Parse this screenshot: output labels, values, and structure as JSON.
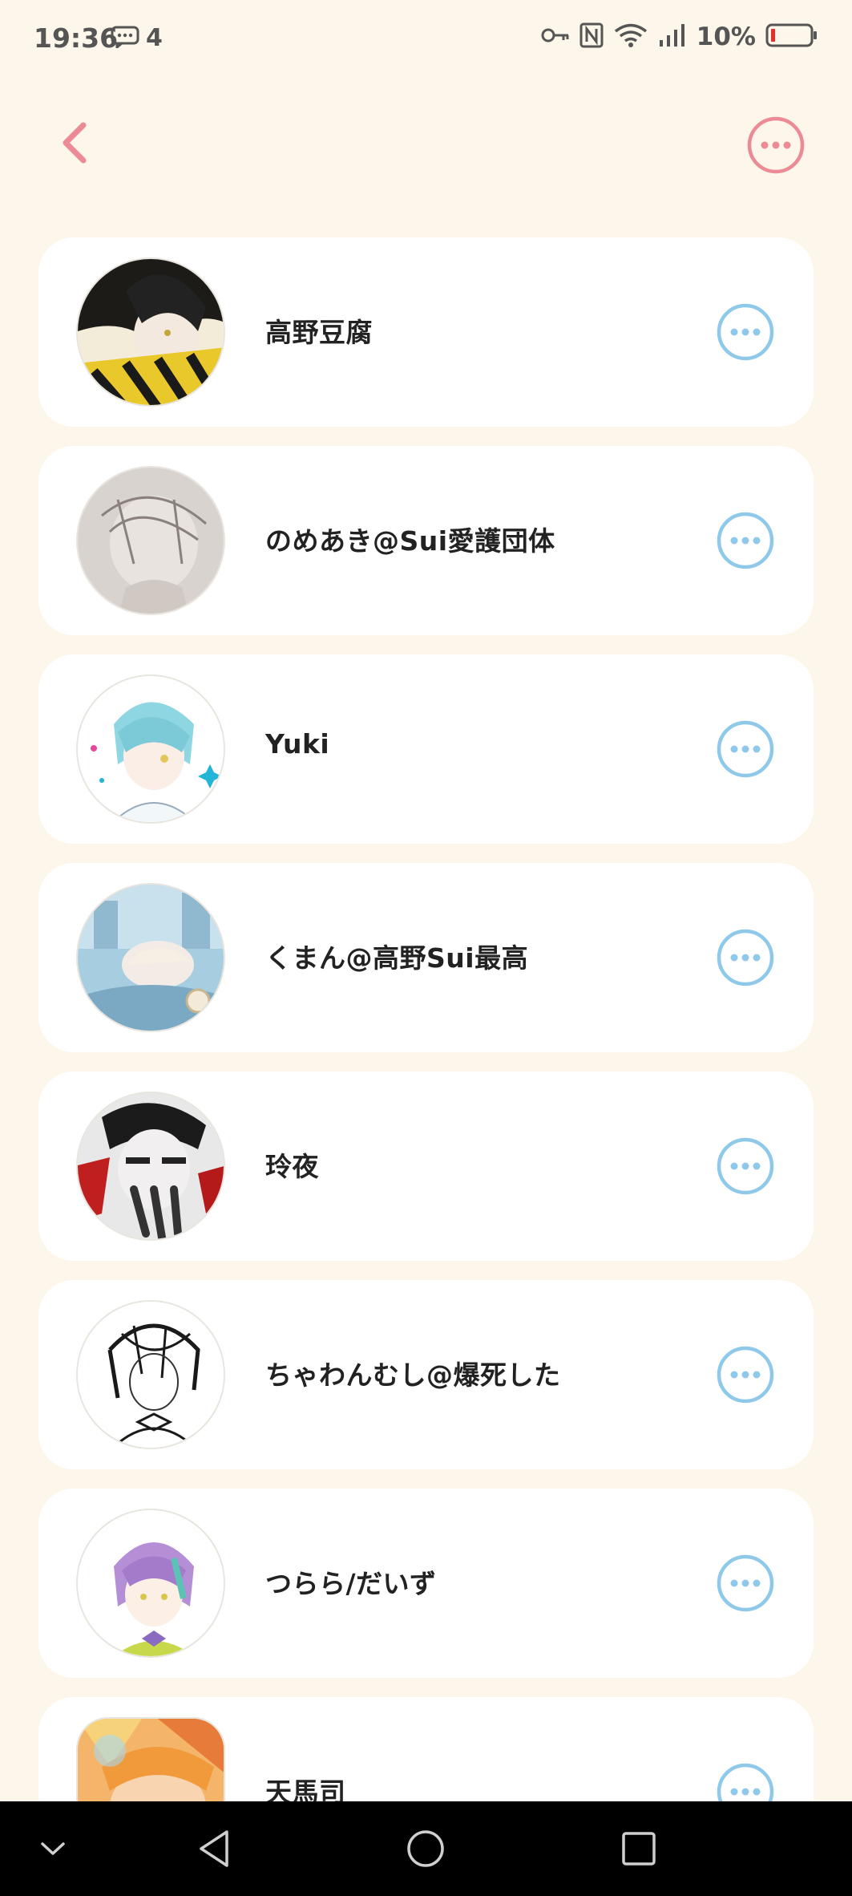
{
  "status_bar": {
    "time": "19:36",
    "notification_count": "4",
    "battery": "10%",
    "icons": [
      "message-icon",
      "key-icon",
      "nfc-icon",
      "wifi-icon",
      "signal-icon",
      "battery-icon"
    ]
  },
  "header": {
    "back_icon": "chevron-left-icon",
    "menu_icon": "more-icon"
  },
  "colors": {
    "background": "#fdf6ea",
    "card": "#ffffff",
    "accent_pink": "#ec8a95",
    "accent_blue": "#8fc9ea",
    "text": "#222222"
  },
  "users": [
    {
      "name": "高野豆腐"
    },
    {
      "name": "のめあき@Sui愛護団体"
    },
    {
      "name": "Yuki"
    },
    {
      "name": "くまん@高野Sui最高"
    },
    {
      "name": "玲夜"
    },
    {
      "name": "ちゃわんむし@爆死した"
    },
    {
      "name": "つらら/だいず"
    },
    {
      "name": "天馬司"
    }
  ],
  "nav_bar": {
    "icons": [
      "collapse-chevron-icon",
      "back-triangle-icon",
      "home-circle-icon",
      "recents-square-icon"
    ]
  }
}
